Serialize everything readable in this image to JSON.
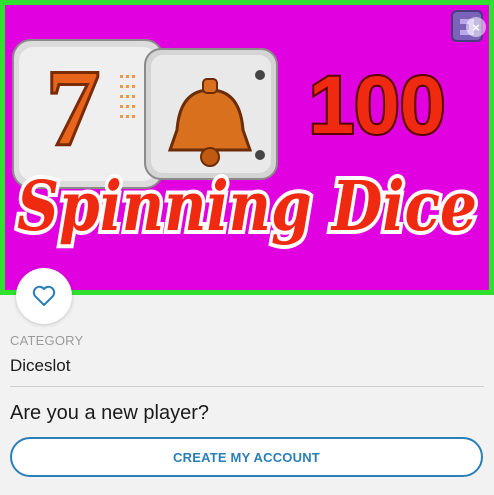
{
  "game": {
    "banner_number": "100",
    "banner_title": "Spinning Dice",
    "provider_logo_icon": "provider-logo-icon",
    "close_icon": "close-icon",
    "close_glyph": "×"
  },
  "favorite": {
    "icon": "heart-icon"
  },
  "category": {
    "label": "CATEGORY",
    "value": "Diceslot"
  },
  "cta": {
    "prompt": "Are you a new player?",
    "button_label": "CREATE MY ACCOUNT"
  },
  "colors": {
    "banner_bg": "#e000e0",
    "banner_border": "#2fe02f",
    "accent": "#2a7fb8"
  }
}
